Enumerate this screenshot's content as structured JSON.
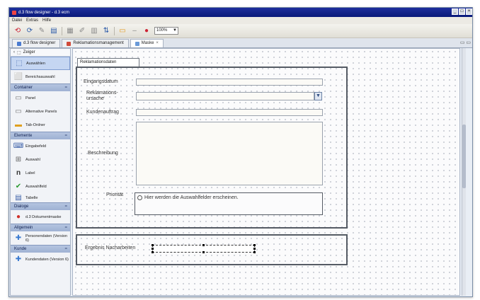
{
  "window": {
    "title": "d.3 flow designer - d.3 ecm"
  },
  "menu": [
    "Datei",
    "Extras",
    "Hilfe"
  ],
  "toolbar": {
    "zoom": "100%"
  },
  "tabs": [
    {
      "label": "d.3 flow designer",
      "active": false
    },
    {
      "label": "Reklamationsmanagement",
      "active": false
    },
    {
      "label": "Maske",
      "active": true
    }
  ],
  "palette": {
    "top_label": "Zeiger",
    "groups": [
      {
        "title": "",
        "items": [
          "Auswählen",
          "Bereichsauswahl"
        ]
      },
      {
        "title": "Container",
        "items": [
          "Panel",
          "Alternative Panels",
          "Tab-Ordner"
        ]
      },
      {
        "title": "Elemente",
        "items": [
          "Eingabefeld",
          "Auswahl",
          "Label",
          "Auswahlfeld",
          "Tabelle"
        ]
      },
      {
        "title": "Dialoge",
        "items": [
          "d.3 Dokumentmaske"
        ]
      },
      {
        "title": "Allgemein",
        "items": [
          "Personendaten (Version 6)"
        ]
      },
      {
        "title": "Kunde",
        "items": [
          "Kundendaten (Version 6)"
        ]
      }
    ]
  },
  "form": {
    "panel_title": "Reklamationsdaten",
    "labels": {
      "eingangsdatum": "Eingangsdatum",
      "reklamationsursache": "Reklamations-\nursache",
      "kundenauftrag": "Kundenauftrag",
      "beschreibung": "Beschreibung",
      "prioritaet": "Priorität"
    },
    "radio_placeholder": "Hier werden die Auswahlfelder erscheinen.",
    "result_label": "Ergebnis Nacharbeiten"
  }
}
